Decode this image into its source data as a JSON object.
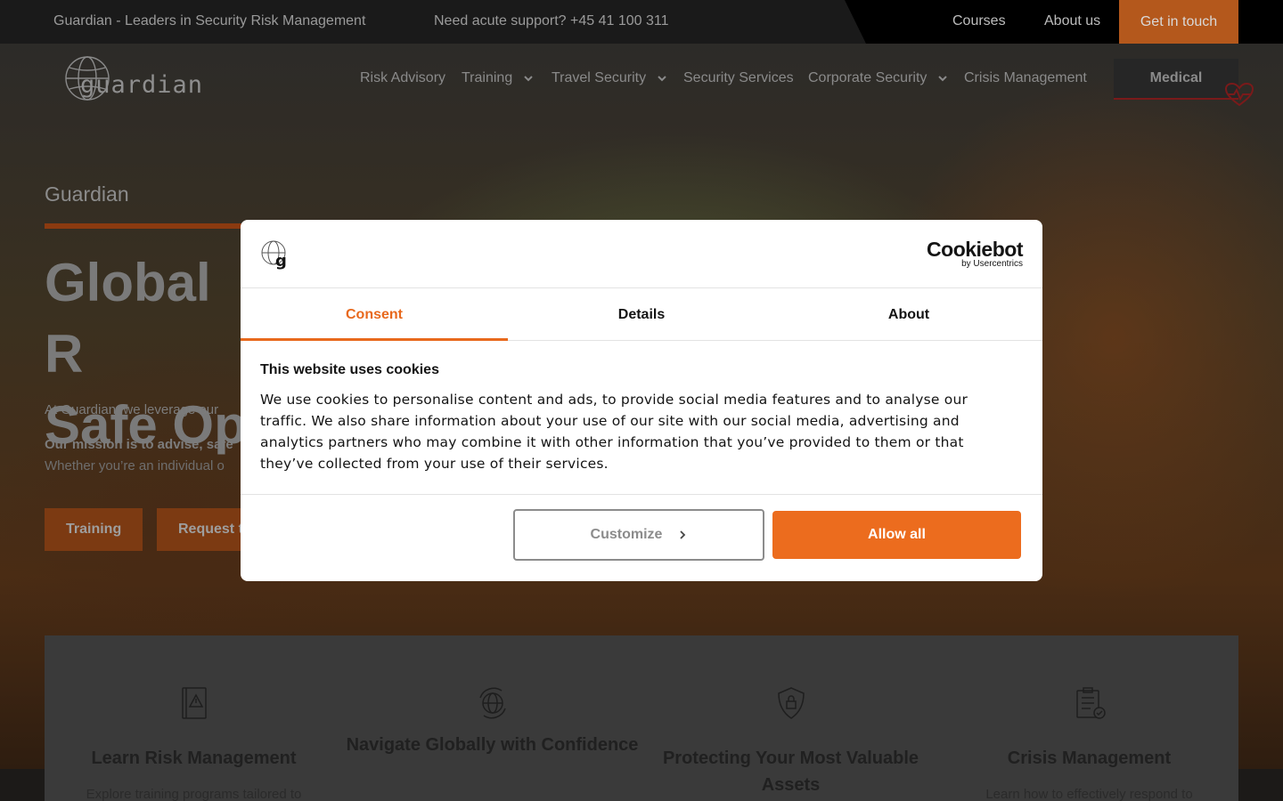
{
  "topbar": {
    "tagline": "Guardian - Leaders in Security Risk Management",
    "support": "Need acute support? +45 41 100 311",
    "links": [
      "Courses",
      "About us"
    ],
    "cta": "Get in touch"
  },
  "logo": {
    "text": "guardian"
  },
  "nav": {
    "items": [
      "Risk Advisory",
      "Training",
      "Travel Security",
      "Security Services",
      "Corporate Security",
      "Crisis Management"
    ],
    "medical": "Medical"
  },
  "hero": {
    "eyebrow": "Guardian",
    "title_line1": "Global R",
    "title_line2": "Safe Op",
    "p1": "At Guardian, we leverage our",
    "p2": "Our mission is to advise, safe",
    "p3": "Whether you’re an individual o",
    "buttons": [
      "Training",
      "Request t"
    ]
  },
  "features": [
    {
      "icon": "warning-book-icon",
      "title": "Learn Risk Management",
      "desc": "Explore training programs tailored to"
    },
    {
      "icon": "globe-icon",
      "title": "Navigate Globally with Confidence",
      "desc": ""
    },
    {
      "icon": "shield-lock-icon",
      "title": "Protecting Your Most Valuable Assets",
      "desc": ""
    },
    {
      "icon": "clipboard-check-icon",
      "title": "Crisis Management",
      "desc": "Learn how to effectively respond to"
    }
  ],
  "cookie_dialog": {
    "brand": "Cookiebot",
    "brand_sub": "by Usercentrics",
    "tabs": [
      "Consent",
      "Details",
      "About"
    ],
    "active_tab": "Consent",
    "title": "This website uses cookies",
    "body": "We use cookies to personalise content and ads, to provide social media features and to analyse our traffic. We also share information about your use of our site with our social media, advertising and analytics partners who may combine it with other information that you’ve provided to them or that they’ve collected from your use of their services.",
    "customize_label": "Customize",
    "allow_label": "Allow all"
  },
  "colors": {
    "accent": "#ec6c1e",
    "topbar_cta": "#b4581c",
    "dialog_bg": "#ffffff"
  }
}
